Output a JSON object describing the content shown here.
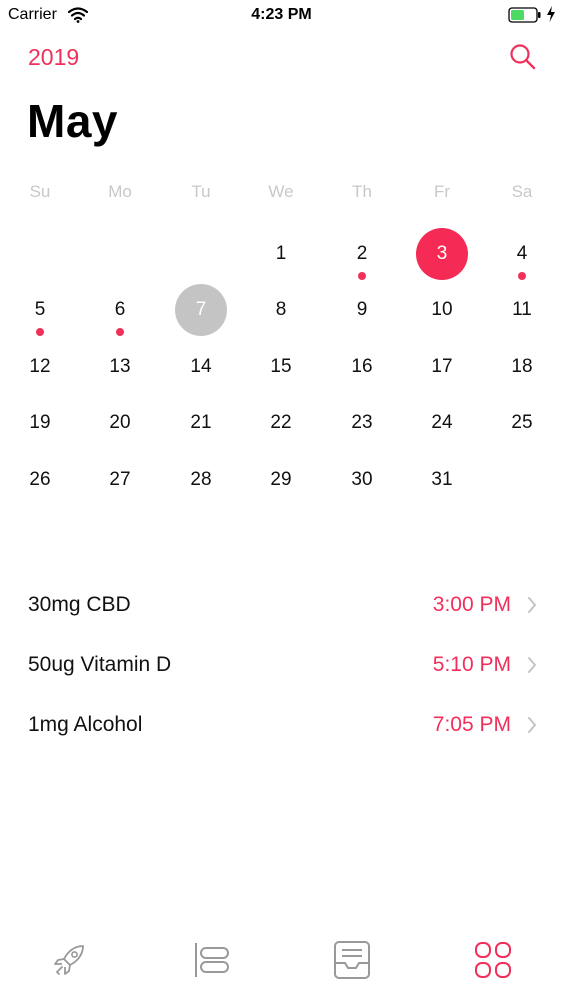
{
  "status_bar": {
    "carrier": "Carrier",
    "time": "4:23 PM"
  },
  "header": {
    "year": "2019",
    "month": "May"
  },
  "weekdays": [
    "Su",
    "Mo",
    "Tu",
    "We",
    "Th",
    "Fr",
    "Sa"
  ],
  "calendar": {
    "first_weekday_index": 3,
    "days": [
      "1",
      "2",
      "3",
      "4",
      "5",
      "6",
      "7",
      "8",
      "9",
      "10",
      "11",
      "12",
      "13",
      "14",
      "15",
      "16",
      "17",
      "18",
      "19",
      "20",
      "21",
      "22",
      "23",
      "24",
      "25",
      "26",
      "27",
      "28",
      "29",
      "30",
      "31"
    ],
    "selected_day": "3",
    "today_day": "7",
    "days_with_events": [
      "2",
      "4",
      "5",
      "6"
    ]
  },
  "doses": [
    {
      "name": "30mg CBD",
      "time": "3:00 PM"
    },
    {
      "name": "50ug Vitamin D",
      "time": "5:10 PM"
    },
    {
      "name": "1mg Alcohol",
      "time": "7:05 PM"
    }
  ],
  "tabs": [
    {
      "icon": "rocket-icon",
      "active": false
    },
    {
      "icon": "timeline-icon",
      "active": false
    },
    {
      "icon": "inbox-icon",
      "active": false
    },
    {
      "icon": "grid-icon",
      "active": true
    }
  ],
  "colors": {
    "accent": "#f0305a",
    "selected_day_bg": "#f52a55",
    "today_bg": "#c4c4c4",
    "weekday_text": "#c8c8c8",
    "inactive_icon": "#999999"
  }
}
